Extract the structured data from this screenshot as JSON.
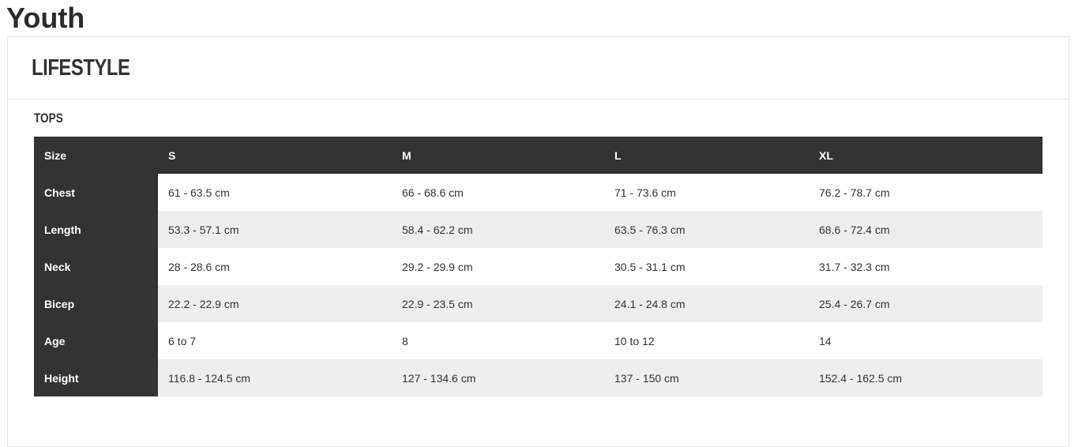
{
  "page": {
    "heading": "Youth"
  },
  "card": {
    "category": "LIFESTYLE",
    "section": "TOPS"
  },
  "colors": {
    "header_bg": "#333333",
    "header_text": "#ffffff",
    "stripe_bg": "#eeeeee",
    "text": "#333333"
  },
  "table": {
    "columns": [
      "Size",
      "S",
      "M",
      "L",
      "XL"
    ],
    "rows": [
      {
        "label": "Chest",
        "values": [
          "61 - 63.5 cm",
          "66 - 68.6 cm",
          "71 - 73.6 cm",
          "76.2 - 78.7 cm"
        ]
      },
      {
        "label": "Length",
        "values": [
          "53.3 - 57.1 cm",
          "58.4 - 62.2 cm",
          "63.5 - 76.3 cm",
          "68.6 - 72.4 cm"
        ]
      },
      {
        "label": "Neck",
        "values": [
          "28 - 28.6 cm",
          "29.2 - 29.9 cm",
          "30.5 - 31.1 cm",
          "31.7 - 32.3 cm"
        ]
      },
      {
        "label": "Bicep",
        "values": [
          "22.2 - 22.9 cm",
          "22.9 - 23.5 cm",
          "24.1 - 24.8 cm",
          "25.4 - 26.7 cm"
        ]
      },
      {
        "label": "Age",
        "values": [
          "6 to 7",
          "8",
          "10 to 12",
          "14"
        ]
      },
      {
        "label": "Height",
        "values": [
          "116.8 - 124.5 cm",
          "127 - 134.6 cm",
          "137 - 150 cm",
          "152.4 - 162.5 cm"
        ]
      }
    ]
  }
}
